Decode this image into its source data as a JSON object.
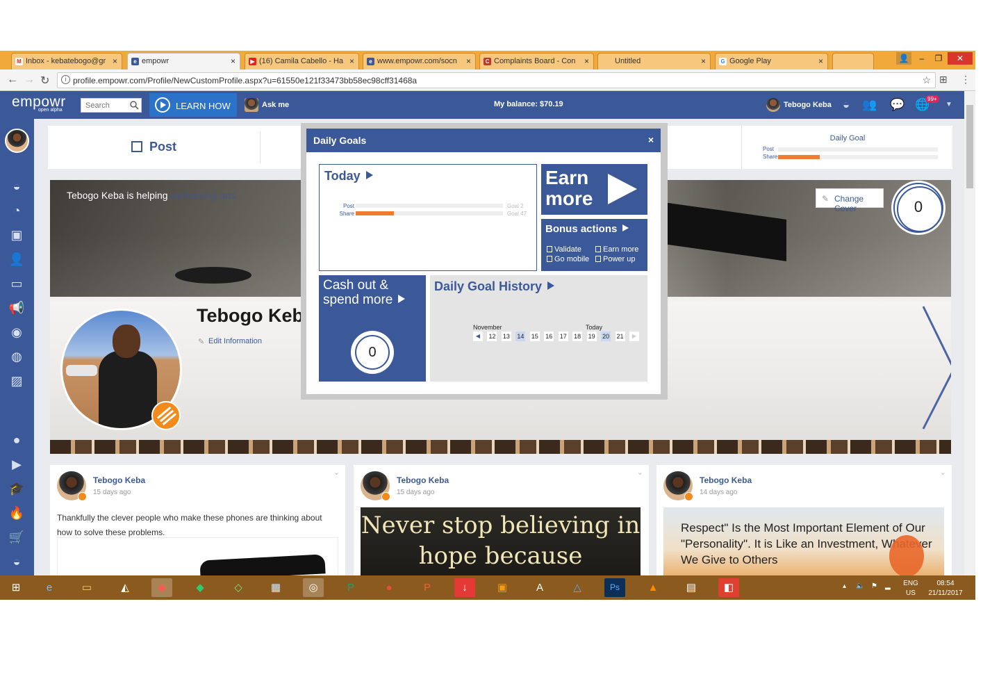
{
  "browser": {
    "tabs": [
      {
        "label": "Inbox - kebatebogo@gr",
        "fav": "M",
        "fav_color": "#d93025",
        "active": false
      },
      {
        "label": "empowr",
        "fav": "e",
        "fav_color": "#3b5998",
        "active": true
      },
      {
        "label": "(16) Camila Cabello - Ha",
        "fav": "▶",
        "fav_color": "#e62117",
        "active": false
      },
      {
        "label": "www.empowr.com/socn",
        "fav": "e",
        "fav_color": "#3b5998",
        "active": false
      },
      {
        "label": "Complaints Board - Con",
        "fav": "C",
        "fav_color": "#c0392b",
        "active": false
      },
      {
        "label": "Untitled",
        "fav": "",
        "fav_color": "#f7c77e",
        "active": false
      },
      {
        "label": "Google Play",
        "fav": "G",
        "fav_color": "#4285f4",
        "active": false
      }
    ],
    "url": "profile.empowr.com/Profile/NewCustomProfile.aspx?u=61550e121f33473bb58ec98cff31468a"
  },
  "topbar": {
    "logo": "empowr",
    "logo_sub": "open alpha",
    "search_placeholder": "Search",
    "learn_how": "LEARN HOW",
    "ask_me": "Ask me",
    "balance": "My balance: $70.19",
    "user_name": "Tebogo Keba",
    "notification_count": "99+"
  },
  "post_bar": {
    "post_label": "Post",
    "daily_goal_title": "Daily Goal",
    "post_label_short": "Post",
    "share_label_short": "Share",
    "share_progress": 0.26
  },
  "cover": {
    "helping_prefix": "Tebogo Keba is helping",
    "helping_cause": "performing arts",
    "change_cover": "Change Cover",
    "counter": "0",
    "profile_name": "Tebogo Keba",
    "edit_info": "Edit Information"
  },
  "modal": {
    "title": "Daily Goals",
    "close": "×",
    "today": {
      "title": "Today",
      "post_label": "Post",
      "share_label": "Share",
      "post_goal": "Goal 2",
      "share_goal": "Goal 47",
      "post_progress": 0.0,
      "share_progress": 0.26
    },
    "earn_more": "Earn more",
    "bonus": {
      "title": "Bonus actions",
      "items": [
        "Validate",
        "Earn more",
        "Go mobile",
        "Power up"
      ]
    },
    "cashout": {
      "text": "Cash out & spend more",
      "counter": "0"
    },
    "history": {
      "title": "Daily Goal History",
      "month": "November",
      "today_label": "Today",
      "days": [
        "12",
        "13",
        "14",
        "15",
        "16",
        "17",
        "18",
        "19",
        "20",
        "21"
      ]
    }
  },
  "feed": [
    {
      "name": "Tebogo Keba",
      "time": "15 days ago",
      "text": "Thankfully the clever people who make these phones are thinking about how to solve these problems."
    },
    {
      "name": "Tebogo Keba",
      "time": "15 days ago",
      "quote": "Never stop believing in hope because"
    },
    {
      "name": "Tebogo Keba",
      "time": "14 days ago",
      "quote": "Respect\" Is the Most Important Element of Our \"Personality\". It is Like an Investment, Whatever We Give to Others"
    }
  ],
  "taskbar": {
    "lang_top": "ENG",
    "lang_bottom": "US",
    "time": "08:54",
    "date": "21/11/2017"
  }
}
